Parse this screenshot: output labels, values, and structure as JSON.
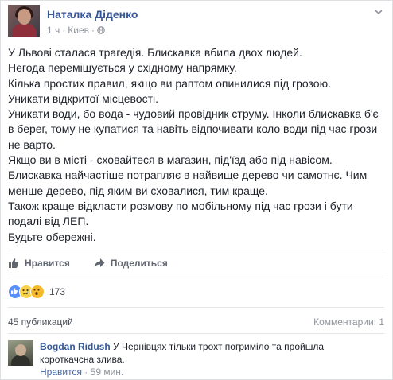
{
  "post": {
    "author": "Наталка Діденко",
    "time": "1 ч",
    "separator": "·",
    "location": "Киев",
    "paragraphs": [
      "У Львові сталася трагедія. Блискавка вбила двох людей.",
      "Негода переміщується у східному напрямку.",
      "Кілька простих правил, якщо ви раптом опинилися під грозою.",
      "Уникати відкритої місцевості.",
      "Уникати води, бо вода - чудовий провідник струму. Інколи блискавка б'є в берег, тому не купатися та навіть відпочивати коло води під час грози не варто.",
      "Якщо ви в місті - сховайтеся в магазин, під'їзд або під навісом.",
      "Блискавка найчастіше потрапляє в найвище дерево чи самотнє. Чим менше дерево, під яким ви сховалися, тим краще.",
      "Також краще відкласти розмову по мобільному під час грози і бути подалі від ЛЕП.",
      "Будьте обережні."
    ]
  },
  "actions": {
    "like_label": "Нравится",
    "share_label": "Поделиться"
  },
  "reactions": {
    "types": [
      "like",
      "sad",
      "wow"
    ],
    "count": "173"
  },
  "stats": {
    "shares": "45 публикаций",
    "comments": "Комментарии: 1"
  },
  "comment": {
    "author": "Bogdan Ridush",
    "text": "У Чернівцях тільки трохт погриміло та пройшла короткачсна злива.",
    "like_label": "Нравится",
    "separator": "·",
    "time": "59 мин."
  },
  "colors": {
    "link_blue": "#365899",
    "meta_gray": "#90949c",
    "text": "#1d2129",
    "like_blue": "#5890ff"
  }
}
